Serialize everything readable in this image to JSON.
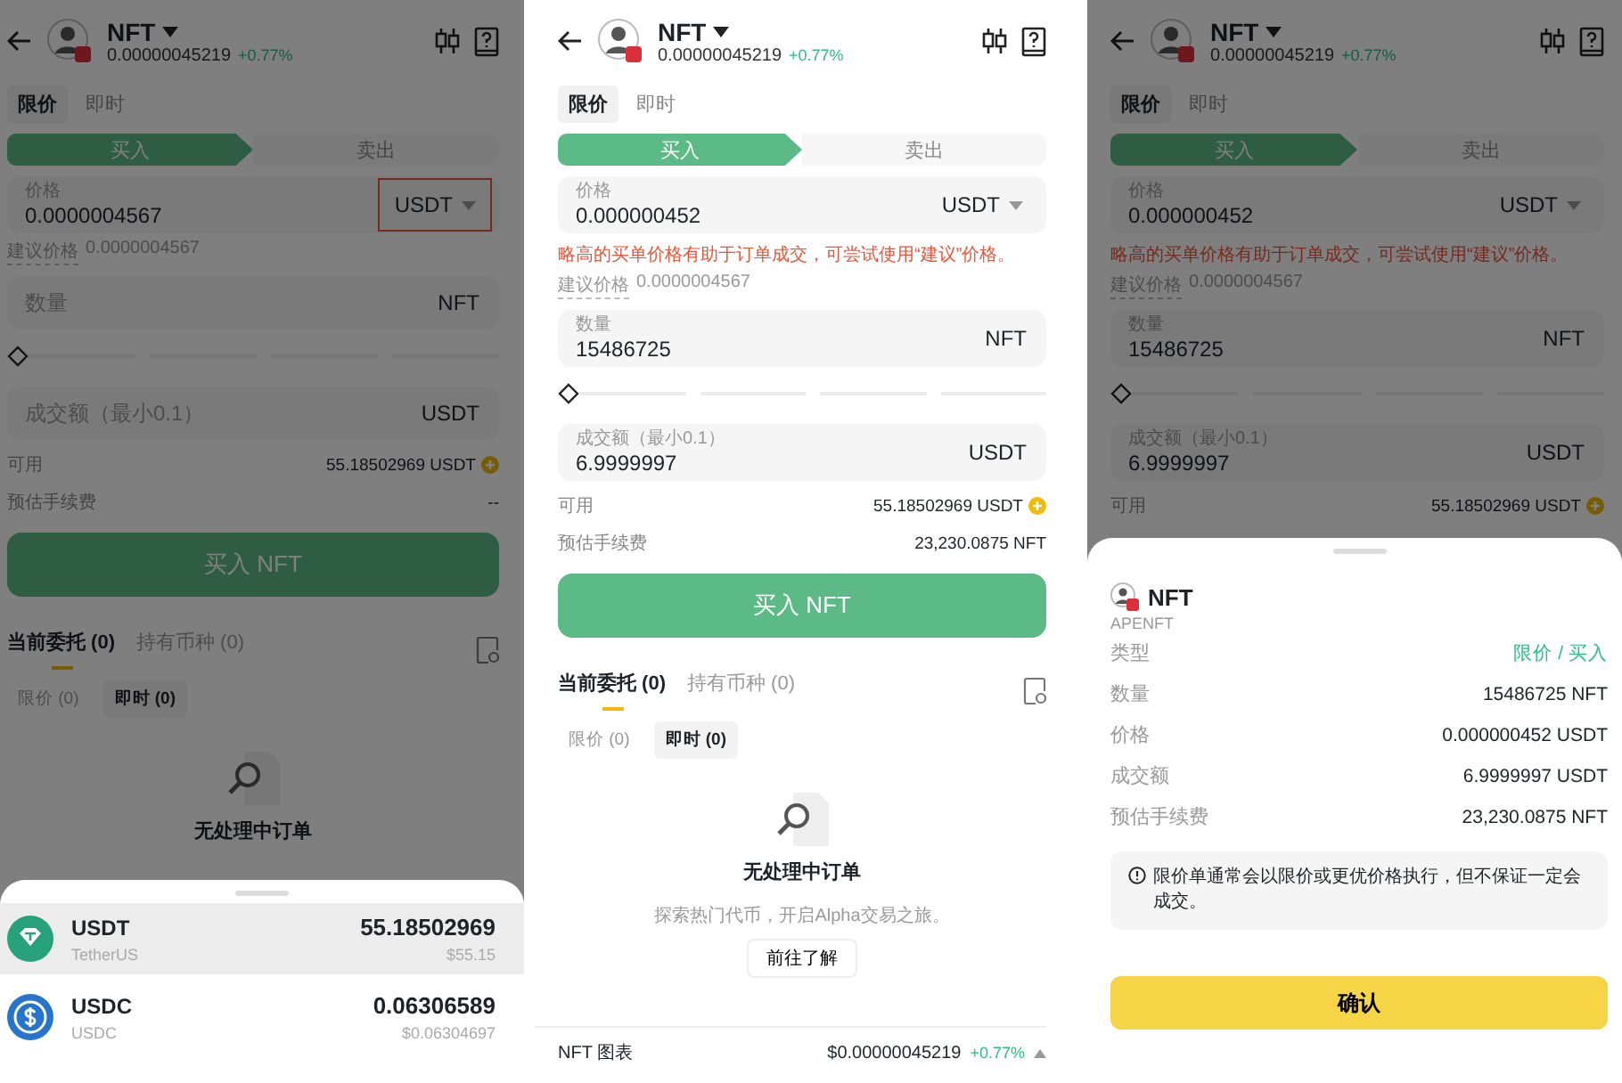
{
  "screens": [
    {
      "dimmed": true,
      "header": {
        "symbol": "NFT",
        "price": "0.00000045219",
        "change": "+0.77%"
      },
      "order_types": [
        {
          "label": "限价",
          "selected": true
        },
        {
          "label": "即时",
          "selected": false
        }
      ],
      "sides": [
        {
          "label": "买入",
          "selected": true
        },
        {
          "label": "卖出",
          "selected": false
        }
      ],
      "price_field": {
        "label": "价格",
        "value": "0.0000004567",
        "unit": "USDT",
        "dropdown": true,
        "highlighted": true
      },
      "suggested": {
        "label": "建议价格",
        "value": "0.0000004567"
      },
      "quantity_field": {
        "placeholder": "数量",
        "unit": "NFT",
        "dropdown": false,
        "highlighted": false
      },
      "slider": {
        "level": 0
      },
      "amount_field": {
        "placeholder": "成交额（最小0.1）",
        "unit": "USDT",
        "dropdown": false,
        "highlighted": false
      },
      "available": {
        "label": "可用",
        "value": "55.18502969 USDT"
      },
      "fee": {
        "label": "预估手续费",
        "value": "--"
      },
      "buy_button": "买入 NFT",
      "orders": {
        "tabs": [
          {
            "label": "当前委托",
            "count": "(0)",
            "selected": true
          },
          {
            "label": "持有币种",
            "count": "(0)",
            "selected": false
          }
        ],
        "filters": [
          {
            "label": "限价 (0)",
            "selected": false
          },
          {
            "label": "即时 (0)",
            "selected": true
          }
        ],
        "empty": {
          "title": "无处理中订单"
        }
      },
      "sheet": {
        "kind": "assets",
        "assets": [
          {
            "kind": "tether",
            "symbol": "USDT",
            "name": "TetherUS",
            "amount": "55.18502969",
            "value": "$55.15",
            "selected": true
          },
          {
            "kind": "usdc",
            "symbol": "USDC",
            "name": "USDC",
            "amount": "0.06306589",
            "value": "$0.06304697",
            "selected": false
          }
        ]
      }
    },
    {
      "dimmed": false,
      "header": {
        "symbol": "NFT",
        "price": "0.00000045219",
        "change": "+0.77%"
      },
      "order_types": [
        {
          "label": "限价",
          "selected": true
        },
        {
          "label": "即时",
          "selected": false
        }
      ],
      "sides": [
        {
          "label": "买入",
          "selected": true
        },
        {
          "label": "卖出",
          "selected": false
        }
      ],
      "price_field": {
        "label": "价格",
        "value": "0.000000452",
        "unit": "USDT",
        "dropdown": true,
        "highlighted": false
      },
      "warning": "略高的买单价格有助于订单成交，可尝试使用“建议”价格。",
      "suggested": {
        "label": "建议价格",
        "value": "0.0000004567"
      },
      "quantity_field": {
        "label": "数量",
        "value": "15486725",
        "unit": "NFT",
        "dropdown": false,
        "highlighted": false
      },
      "slider": {
        "level": 0
      },
      "amount_field": {
        "label": "成交额（最小0.1）",
        "value": "6.9999997",
        "unit": "USDT",
        "dropdown": false,
        "highlighted": false
      },
      "available": {
        "label": "可用",
        "value": "55.18502969 USDT"
      },
      "fee": {
        "label": "预估手续费",
        "value": "23,230.0875 NFT"
      },
      "buy_button": "买入 NFT",
      "orders": {
        "tabs": [
          {
            "label": "当前委托",
            "count": "(0)",
            "selected": true
          },
          {
            "label": "持有币种",
            "count": "(0)",
            "selected": false
          }
        ],
        "filters": [
          {
            "label": "限价 (0)",
            "selected": false
          },
          {
            "label": "即时 (0)",
            "selected": true
          }
        ],
        "empty": {
          "title": "无处理中订单",
          "subtitle": "探索热门代币，开启Alpha交易之旅。",
          "button": "前往了解"
        }
      },
      "bottom_bar": {
        "label": "NFT 图表",
        "price": "$0.00000045219",
        "change": "+0.77%"
      }
    },
    {
      "dimmed": true,
      "header": {
        "symbol": "NFT",
        "price": "0.00000045219",
        "change": "+0.77%"
      },
      "order_types": [
        {
          "label": "限价",
          "selected": true
        },
        {
          "label": "即时",
          "selected": false
        }
      ],
      "sides": [
        {
          "label": "买入",
          "selected": true
        },
        {
          "label": "卖出",
          "selected": false
        }
      ],
      "price_field": {
        "label": "价格",
        "value": "0.000000452",
        "unit": "USDT",
        "dropdown": true,
        "highlighted": false
      },
      "warning": "略高的买单价格有助于订单成交，可尝试使用“建议”价格。",
      "suggested": {
        "label": "建议价格",
        "value": "0.0000004567"
      },
      "quantity_field": {
        "label": "数量",
        "value": "15486725",
        "unit": "NFT",
        "dropdown": false,
        "highlighted": false
      },
      "slider": {
        "level": 0
      },
      "amount_field": {
        "label": "成交额（最小0.1）",
        "value": "6.9999997",
        "unit": "USDT",
        "dropdown": false,
        "highlighted": false
      },
      "available": {
        "label": "可用",
        "value": "55.18502969 USDT"
      },
      "sheet": {
        "kind": "confirm",
        "symbol": "NFT",
        "name": "APENFT",
        "rows": [
          {
            "label": "类型",
            "value": "限价 / 买入",
            "positive": true
          },
          {
            "label": "数量",
            "value": "15486725 NFT",
            "positive": false
          },
          {
            "label": "价格",
            "value": "0.000000452 USDT",
            "positive": false
          },
          {
            "label": "成交额",
            "value": "6.9999997 USDT",
            "positive": false
          },
          {
            "label": "预估手续费",
            "value": "23,230.0875 NFT",
            "positive": false
          }
        ],
        "notice": "限价单通常会以限价或更优价格执行，但不保证一定会成交。",
        "button": "确认"
      }
    }
  ]
}
